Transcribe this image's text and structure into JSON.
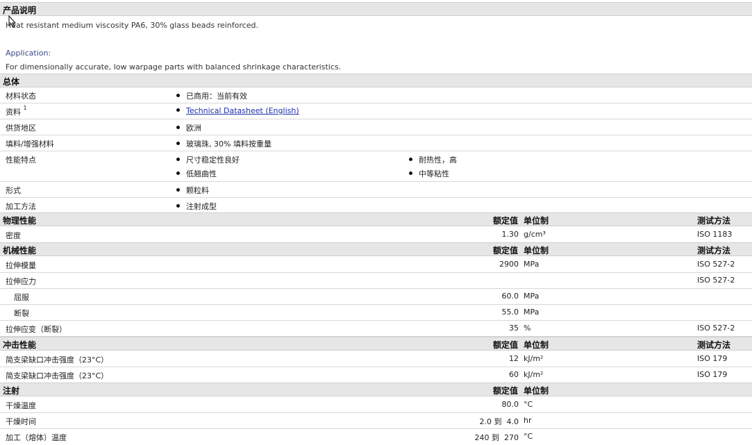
{
  "description": {
    "heading": "产品说明",
    "line1": "Heat resistant medium viscosity PA6, 30% glass beads reinforced.",
    "application_label": "Application:",
    "application_text": "For dimensionally accurate, low warpage parts with balanced shrinkage characteristics."
  },
  "general": {
    "heading": "总体",
    "rows": [
      {
        "label": "材料状态",
        "value": "已商用：当前有效"
      },
      {
        "label": "资料",
        "footnote": "1",
        "value": "Technical Datasheet (English)"
      },
      {
        "label": "供货地区",
        "value": "欧洲"
      },
      {
        "label": "填料/增强材料",
        "value": "玻璃珠, 30% 填料按重量"
      },
      {
        "label": "性能特点",
        "values": [
          "尺寸稳定性良好",
          "耐热性，高",
          "低翘曲性",
          "中等粘性"
        ]
      },
      {
        "label": "形式",
        "value": "颗粒料"
      },
      {
        "label": "加工方法",
        "value": "注射成型"
      }
    ]
  },
  "headers": {
    "nominal": "额定值",
    "unit": "单位制",
    "method": "测试方法"
  },
  "physical": {
    "heading": "物理性能",
    "rows": [
      {
        "label": "密度",
        "value": "1.30",
        "unit": "g/cm³",
        "method": "ISO 1183"
      }
    ]
  },
  "mechanical": {
    "heading": "机械性能",
    "rows": [
      {
        "label": "拉伸模量",
        "value": "2900",
        "unit": "MPa",
        "method": "ISO 527-2"
      },
      {
        "label": "拉伸应力",
        "value": "",
        "unit": "",
        "method": "ISO 527-2"
      },
      {
        "label": "屈服",
        "value": "60.0",
        "unit": "MPa",
        "method": ""
      },
      {
        "label": "断裂",
        "value": "55.0",
        "unit": "MPa",
        "method": ""
      },
      {
        "label": "拉伸应变（断裂）",
        "value": "35",
        "unit": "%",
        "method": "ISO 527-2"
      }
    ]
  },
  "impact": {
    "heading": "冲击性能",
    "rows": [
      {
        "label": "简支梁缺口冲击强度（23°C）",
        "value": "12",
        "unit": "kJ/m²",
        "method": "ISO 179"
      },
      {
        "label": "简支梁缺口冲击强度（23°C）",
        "value": "60",
        "unit": "kJ/m²",
        "method": "ISO 179"
      }
    ]
  },
  "injection": {
    "heading": "注射",
    "rows": [
      {
        "label": "干燥温度",
        "value": "80.0",
        "unit": "°C"
      },
      {
        "label": "干燥时间",
        "value": "2.0 到  4.0",
        "unit": "hr"
      },
      {
        "label": "加工（熔体）温度",
        "value": "240 到  270",
        "unit": "°C"
      }
    ]
  }
}
